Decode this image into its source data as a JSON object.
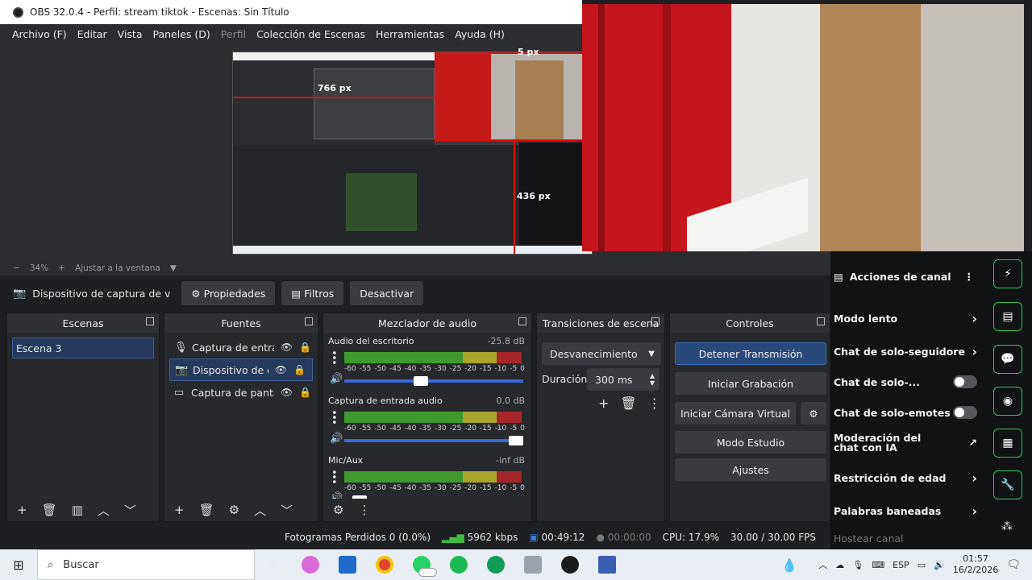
{
  "window": {
    "title": "OBS 32.0.4 - Perfil: stream tiktok - Escenas: Sin Título"
  },
  "menu": [
    "Archivo (F)",
    "Editar",
    "Vista",
    "Paneles (D)",
    "Perfil",
    "Colección de Escenas",
    "Herramientas",
    "Ayuda (H)"
  ],
  "preview": {
    "measure_top": "5 px",
    "measure_left": "766 px",
    "measure_mid": "436 px"
  },
  "zoom": {
    "minus": "−",
    "level": "34%",
    "plus": "+",
    "fit_label": "Ajustar a la ventana"
  },
  "source_toolbar": {
    "source_name": "Dispositivo de captura de v",
    "properties": "Propiedades",
    "filters": "Filtros",
    "deactivate": "Desactivar"
  },
  "scenes": {
    "title": "Escenas",
    "items": [
      "Escena 3"
    ]
  },
  "sources": {
    "title": "Fuentes",
    "items": [
      "Captura de entrad",
      "Dispositivo de capt",
      "Captura de pantall"
    ]
  },
  "mixer": {
    "title": "Mezclador de audio",
    "ticks": [
      "-60",
      "-55",
      "-50",
      "-45",
      "-40",
      "-35",
      "-30",
      "-25",
      "-20",
      "-15",
      "-10",
      "-5",
      "0"
    ],
    "channels": [
      {
        "name": "Audio del escritorio",
        "db": "-25.8 dB",
        "volume": 0.42
      },
      {
        "name": "Captura de entrada audio",
        "db": "0.0 dB",
        "volume": 1.0
      },
      {
        "name": "Mic/Aux",
        "db": "-inf dB",
        "volume": 0.05
      }
    ]
  },
  "transitions": {
    "title": "Transiciones de escena",
    "selected": "Desvanecimiento",
    "duration_label": "Duración",
    "duration_value": "300 ms"
  },
  "controls": {
    "title": "Controles",
    "stop_stream": "Detener Transmisión",
    "start_recording": "Iniciar Grabación",
    "start_virtual_cam": "Iniciar Cámara Virtual",
    "studio_mode": "Modo Estudio",
    "settings": "Ajustes"
  },
  "status": {
    "dropped_frames": "Fotogramas Perdidos 0 (0.0%)",
    "bitrate": "5962 kbps",
    "stream_time": "00:49:12",
    "record_time": "00:00:00",
    "cpu": "CPU: 17.9%",
    "fps": "30.00 / 30.00 FPS"
  },
  "tiktok": {
    "header": "Acciones de canal",
    "items": [
      "Modo lento",
      "Chat de solo-seguidore",
      "Chat de solo-...",
      "Chat de solo-emotes",
      "Moderación del chat con IA",
      "Restricción de edad",
      "Palabras baneadas",
      "Hostear canal"
    ]
  },
  "taskbar": {
    "search": "Buscar",
    "badge": "99+",
    "lang": "ESP",
    "time": "01:57",
    "date": "16/2/2026"
  },
  "colors": {
    "accent": "#3b6bb0",
    "tiktok_green": "#34c45a",
    "meter_green": "#3f9a2d",
    "meter_yellow": "#a7a52b",
    "meter_red": "#a7262a"
  }
}
